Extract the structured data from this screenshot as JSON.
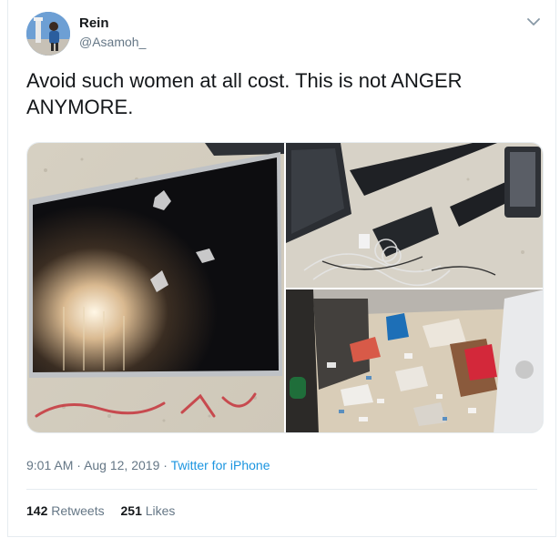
{
  "tweet": {
    "author_name": "Rein",
    "author_handle": "@Asamoh_",
    "text": "Avoid such women at all cost. This is not ANGER ANYMORE.",
    "time": "9:01 AM",
    "date": "Aug 12, 2019",
    "source": "Twitter for iPhone",
    "separator": "·",
    "retweets_count": "142",
    "retweets_label": "Retweets",
    "likes_count": "251",
    "likes_label": "Likes"
  },
  "icons": {
    "menu": "chevron-down-icon"
  },
  "colors": {
    "link": "#1b95e0",
    "secondary_text": "#657786",
    "primary_text": "#14171a",
    "border": "#e6ecf0"
  },
  "photos": [
    {
      "name": "broken-tv-photo"
    },
    {
      "name": "broken-speakers-photo"
    },
    {
      "name": "messy-room-photo"
    }
  ]
}
